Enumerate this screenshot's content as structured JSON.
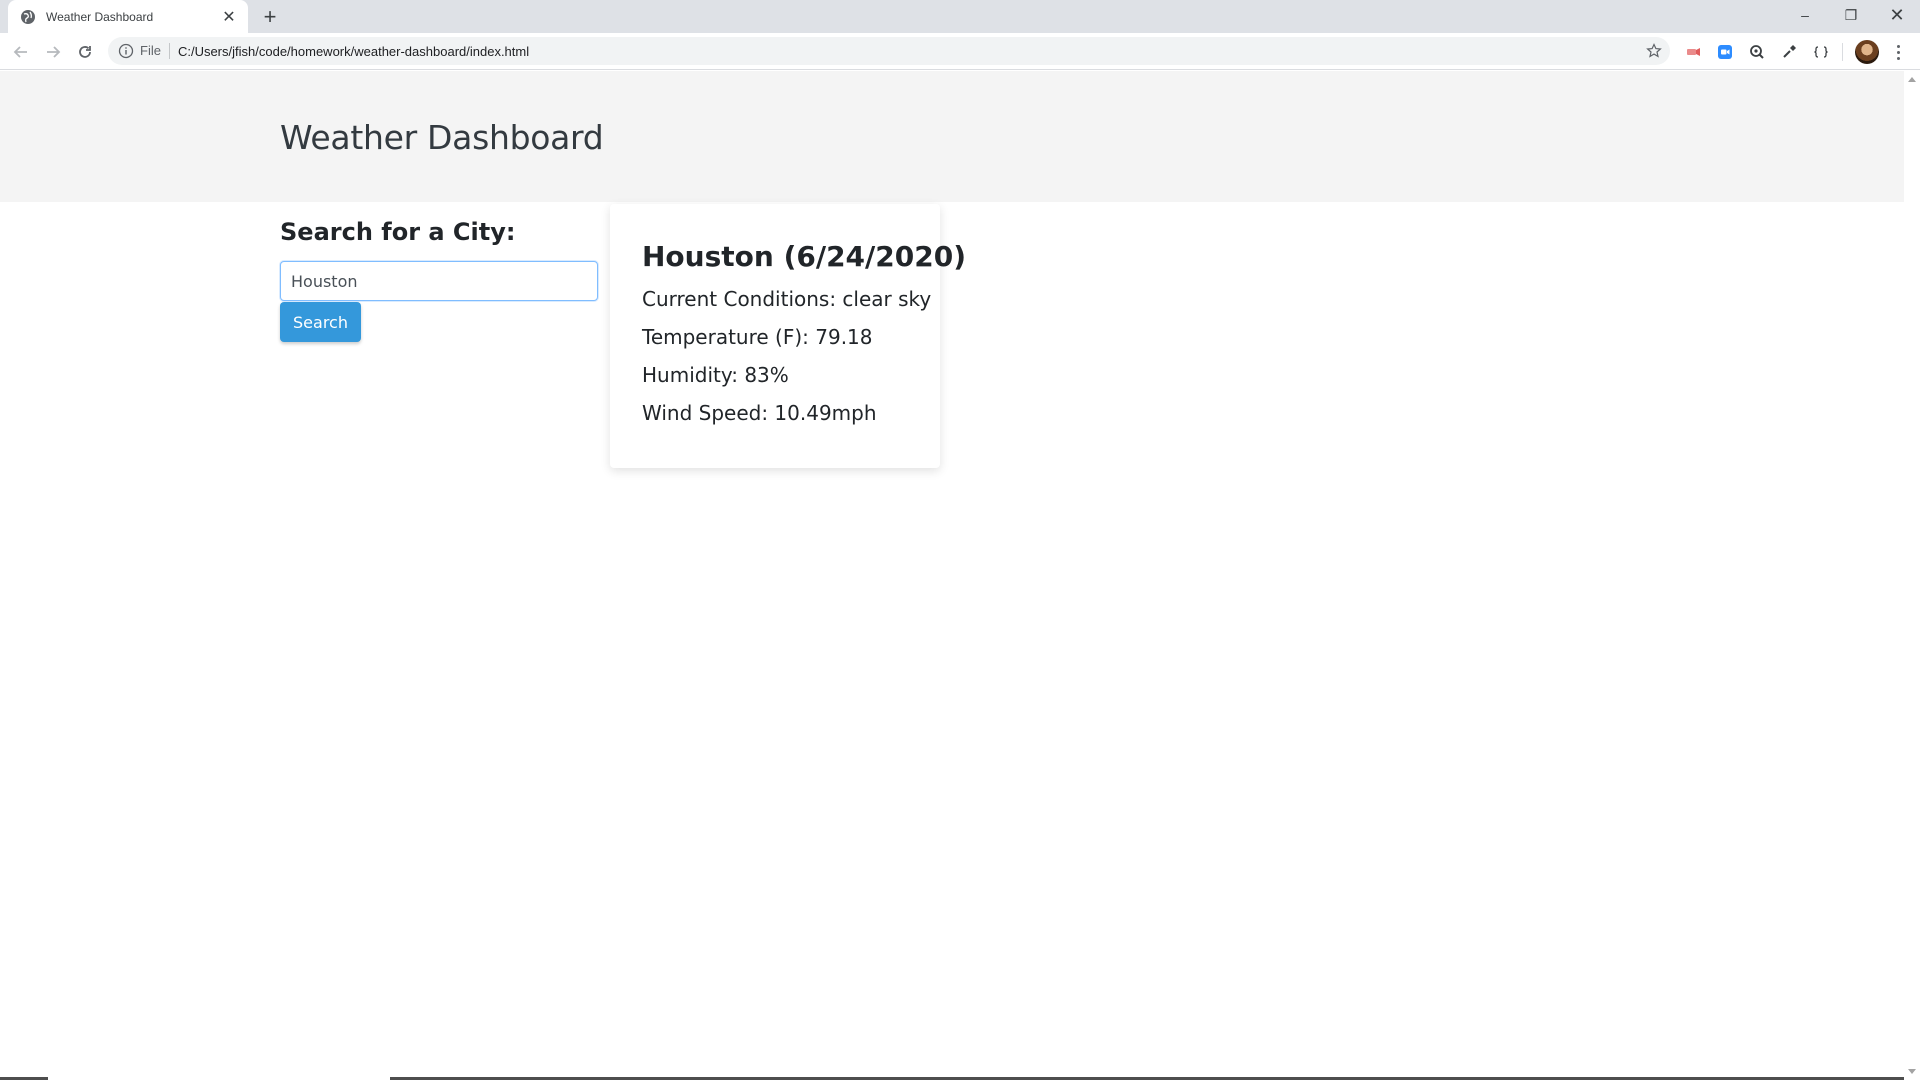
{
  "browser": {
    "tab_title": "Weather Dashboard",
    "scheme_label": "File",
    "url": "C:/Users/jfish/code/homework/weather-dashboard/index.html",
    "icons": {
      "favicon": "globe-icon",
      "close": "close-icon",
      "new_tab": "plus-icon",
      "back": "arrow-left-icon",
      "forward": "arrow-right-icon",
      "reload": "reload-icon",
      "info": "info-icon",
      "bookmark": "star-icon",
      "menu": "kebab-menu-icon"
    },
    "window_controls": {
      "minimize": "–",
      "maximize": "❐",
      "close": "✕"
    }
  },
  "page": {
    "title": "Weather Dashboard",
    "search": {
      "heading": "Search for a City:",
      "input_value": "Houston",
      "button_label": "Search"
    },
    "weather": {
      "title": "Houston (6/24/2020)",
      "conditions": "Current Conditions: clear sky",
      "temperature": "Temperature (F): 79.18",
      "humidity": "Humidity: 83%",
      "wind": "Wind Speed: 10.49mph"
    }
  },
  "colors": {
    "accent": "#3498db",
    "jumbotron_bg": "#f4f4f4",
    "text": "#212529"
  }
}
